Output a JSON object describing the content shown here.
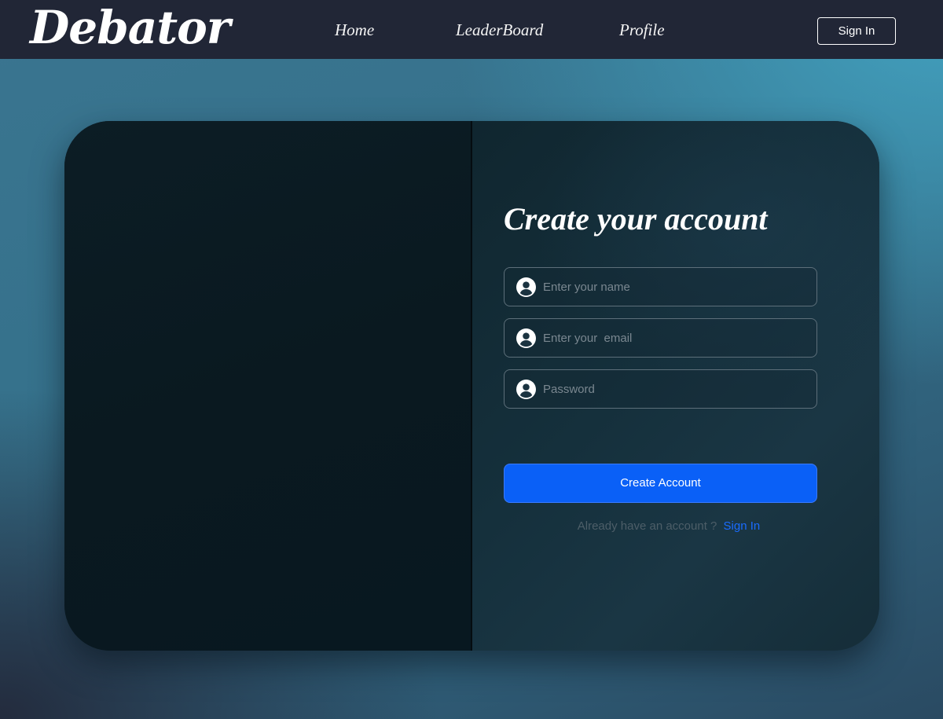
{
  "navbar": {
    "logo": "Debator",
    "links": [
      "Home",
      "LeaderBoard",
      "Profile"
    ],
    "signin_label": "Sign In"
  },
  "form": {
    "title": "Create your account",
    "name_placeholder": "Enter your name",
    "email_placeholder": "Enter your  email",
    "password_placeholder": "Password",
    "submit_label": "Create Account",
    "signin_prompt": "Already have an account ?",
    "signin_link": "Sign In",
    "field_icon": "user-circle-icon"
  },
  "colors": {
    "navbar_bg": "#212636",
    "accent": "#0a60f7",
    "link": "#1a6cff"
  }
}
